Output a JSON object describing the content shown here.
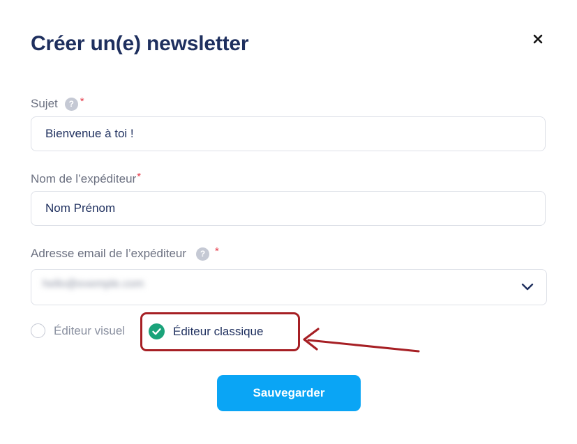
{
  "dialog": {
    "title": "Créer un(e) newsletter",
    "close_icon": "close-icon"
  },
  "subject": {
    "label": "Sujet",
    "required_mark": "*",
    "help_icon": "help-icon",
    "help_glyph": "?",
    "value": "Bienvenue à toi !"
  },
  "sender_name": {
    "label": "Nom de l’expéditeur",
    "required_mark": "*",
    "value": "Nom Prénom"
  },
  "sender_email": {
    "label": "Adresse email de l’expéditeur",
    "required_mark": "*",
    "help_icon": "help-icon",
    "help_glyph": "?",
    "value_blurred": "hello@exemple.com",
    "dropdown_icon": "chevron-down-icon"
  },
  "editor": {
    "options": [
      {
        "label": "Éditeur visuel",
        "selected": false
      },
      {
        "label": "Éditeur classique",
        "selected": true
      }
    ],
    "selected_icon": "check-circle-icon",
    "selected_color": "#1aa37a",
    "highlight_color": "#a61f24"
  },
  "actions": {
    "save_label": "Sauvegarder",
    "save_color": "#0aa5f5"
  }
}
